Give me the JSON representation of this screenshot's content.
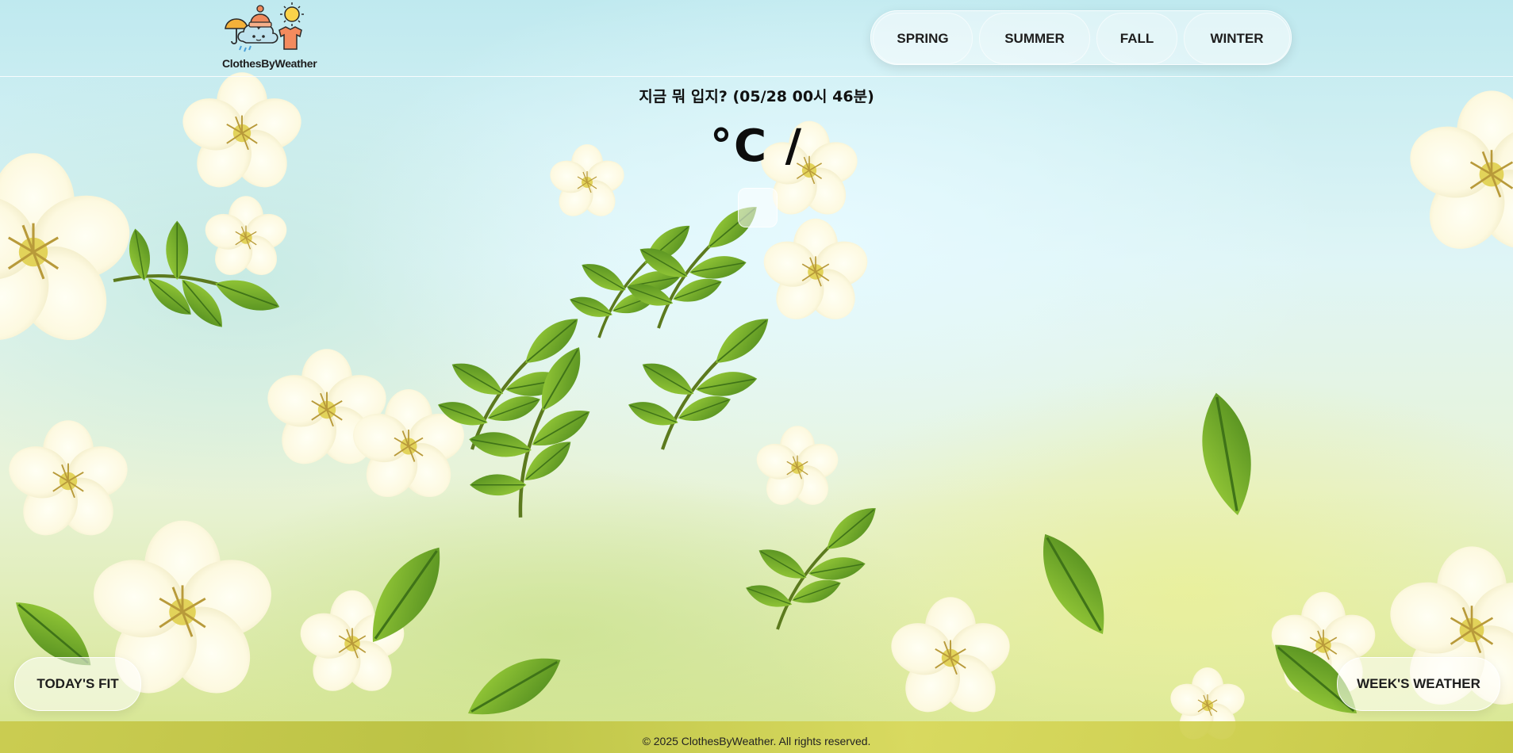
{
  "header": {
    "logo_text": "ClothesByWeather",
    "nav": [
      {
        "label": "SPRING"
      },
      {
        "label": "SUMMER"
      },
      {
        "label": "FALL"
      },
      {
        "label": "WINTER"
      }
    ]
  },
  "main": {
    "headline": "지금 뭐 입지? (05/28 00시 46분)",
    "temperature_line": "°C /"
  },
  "buttons": {
    "todays_fit": "TODAY'S FIT",
    "weeks_weather": "WEEK'S WEATHER"
  },
  "footer": {
    "copyright": "© 2025 ClothesByWeather. All rights reserved."
  },
  "colors": {
    "blossom": "#fdfbee",
    "blossom_center": "#e6d25a",
    "leaf": "#7ab82e",
    "leaf_dark": "#4f8a1e",
    "text": "#111111"
  },
  "icons": [
    "umbrella-icon",
    "cloud-icon",
    "beanie-icon",
    "sun-icon",
    "tshirt-icon"
  ]
}
